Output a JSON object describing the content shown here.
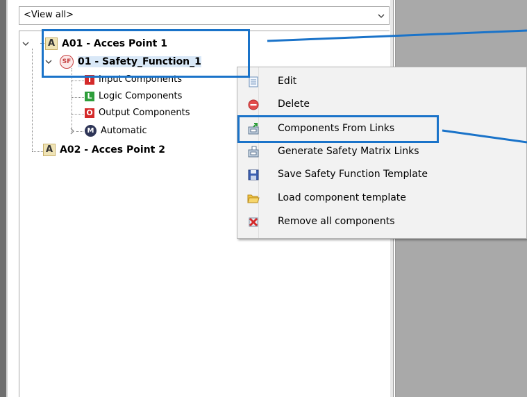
{
  "filter": {
    "selected": "<View all>"
  },
  "tree": {
    "root1": {
      "prefix": "A",
      "label": "A01 - Acces Point 1"
    },
    "safety_function": {
      "prefix": "SF",
      "label": "01 - Safety_Function_1"
    },
    "input": {
      "prefix": "I",
      "label": "Input Components"
    },
    "logic": {
      "prefix": "L",
      "label": "Logic Components"
    },
    "output": {
      "prefix": "O",
      "label": "Output Components"
    },
    "automatic": {
      "prefix": "M",
      "label": "Automatic"
    },
    "root2": {
      "prefix": "A",
      "label": "A02 - Acces Point 2"
    }
  },
  "context_menu": {
    "items": [
      {
        "label": "Edit",
        "icon": "edit-icon"
      },
      {
        "label": "Delete",
        "icon": "delete-icon"
      },
      {
        "label": "Components From Links",
        "icon": "components-from-links-icon"
      },
      {
        "label": "Generate Safety Matrix Links",
        "icon": "generate-links-icon"
      },
      {
        "label": "Save Safety Function Template",
        "icon": "save-icon"
      },
      {
        "label": "Load component template",
        "icon": "folder-open-icon"
      },
      {
        "label": "Remove all components",
        "icon": "remove-all-icon"
      }
    ]
  },
  "colors": {
    "callout": "#1a73c9",
    "input_icon": "#d42a2a",
    "logic_icon": "#2e9e3b",
    "output_icon": "#d42a2a",
    "splitter": "#a9a9a9"
  }
}
